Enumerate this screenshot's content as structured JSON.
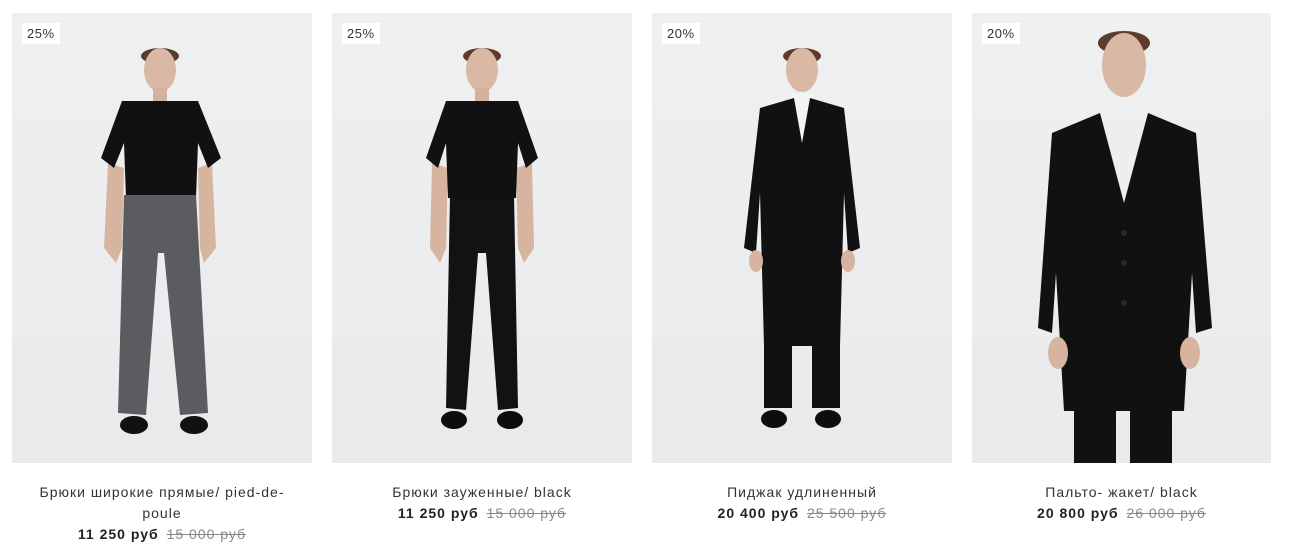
{
  "products": [
    {
      "badge": "25%",
      "title": "Брюки широкие прямые/ pied-de-poule",
      "price": "11 250 руб",
      "old_price": "15 000 руб"
    },
    {
      "badge": "25%",
      "title": "Брюки зауженные/ black",
      "price": "11 250 руб",
      "old_price": "15 000 руб"
    },
    {
      "badge": "20%",
      "title": "Пиджак удлиненный",
      "price": "20 400 руб",
      "old_price": "25 500 руб"
    },
    {
      "badge": "20%",
      "title": "Пальто- жакет/ black",
      "price": "20 800 руб",
      "old_price": "26 000 руб"
    }
  ],
  "colors": {
    "photo_bg": "#eceeef",
    "garment_black": "#111111",
    "trousers_grey": "#5a5c5f",
    "skin": "#d9b9a5",
    "hair": "#5b3b2a"
  }
}
